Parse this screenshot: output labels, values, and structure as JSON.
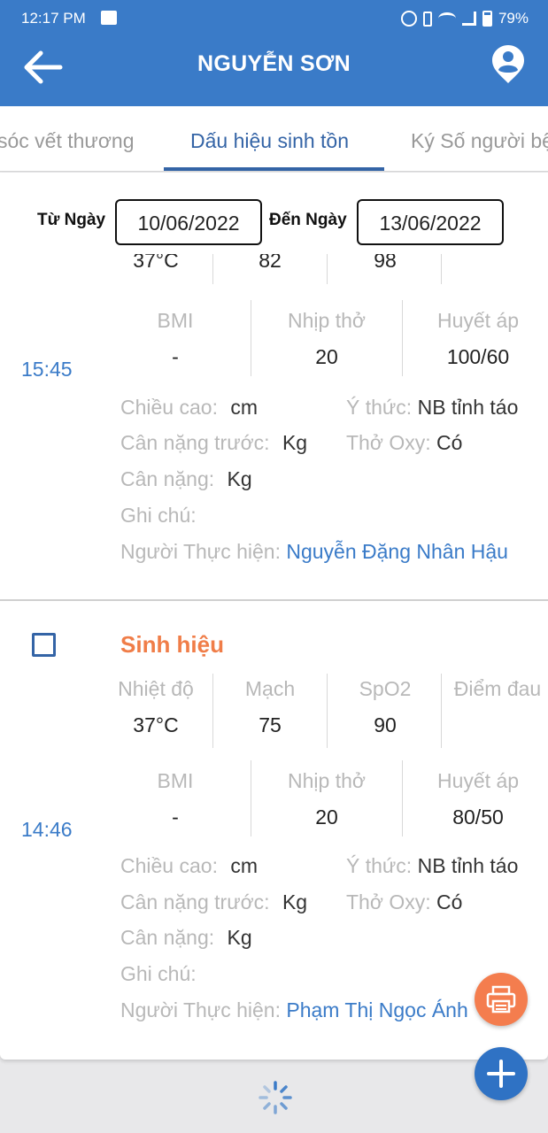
{
  "status_bar": {
    "time": "12:17 PM",
    "battery": "79%"
  },
  "app_bar": {
    "title": "NGUYỄN SƠN"
  },
  "tabs": [
    {
      "label": "sóc vết thương"
    },
    {
      "label": "Dấu hiệu sinh tồn"
    },
    {
      "label": "Ký Số người bệnh"
    }
  ],
  "filter": {
    "from_label": "Từ Ngày",
    "from_value": "10/06/2022",
    "to_label": "Đến Ngày",
    "to_value": "13/06/2022"
  },
  "records": [
    {
      "partial_values": [
        "37°C",
        "82",
        "98"
      ],
      "bmi_label": "BMI",
      "bmi": "-",
      "rr_label": "Nhịp thở",
      "rr": "20",
      "bp_label": "Huyết áp",
      "bp": "100/60",
      "time": "15:45",
      "height_label": "Chiều cao:",
      "height_unit": "cm",
      "consciousness_label": "Ý thức:",
      "consciousness": "NB tỉnh táo",
      "prev_weight_label": "Cân nặng trước:",
      "prev_weight_unit": "Kg",
      "oxygen_label": "Thở Oxy:",
      "oxygen": "Có",
      "weight_label": "Cân nặng:",
      "weight_unit": "Kg",
      "note_label": "Ghi chú:",
      "performer_label": "Người Thực hiện:",
      "performer": "Nguyễn Đặng Nhân Hậu"
    },
    {
      "title": "Sinh hiệu",
      "temp_label": "Nhiệt độ",
      "temp": "37°C",
      "pulse_label": "Mạch",
      "pulse": "75",
      "spo2_label": "SpO2",
      "spo2": "90",
      "pain_label": "Điểm đau",
      "bmi_label": "BMI",
      "bmi": "-",
      "rr_label": "Nhịp thở",
      "rr": "20",
      "bp_label": "Huyết áp",
      "bp": "80/50",
      "time": "14:46",
      "height_label": "Chiều cao:",
      "height_unit": "cm",
      "consciousness_label": "Ý thức:",
      "consciousness": "NB tỉnh táo",
      "prev_weight_label": "Cân nặng trước:",
      "prev_weight_unit": "Kg",
      "oxygen_label": "Thở Oxy:",
      "oxygen": "Có",
      "weight_label": "Cân nặng:",
      "weight_unit": "Kg",
      "note_label": "Ghi chú:",
      "performer_label": "Người Thực hiện:",
      "performer": "Phạm Thị Ngọc Ánh"
    }
  ],
  "colors": {
    "primary": "#3a7bc8",
    "accent": "#f07d48",
    "tab_active": "#3464a6",
    "fab_print": "#f47d4e",
    "fab_add": "#2f72c4"
  },
  "icons": [
    "back-arrow-icon",
    "user-icon",
    "checkbox-icon",
    "print-icon",
    "plus-icon",
    "loading-spinner-icon"
  ]
}
